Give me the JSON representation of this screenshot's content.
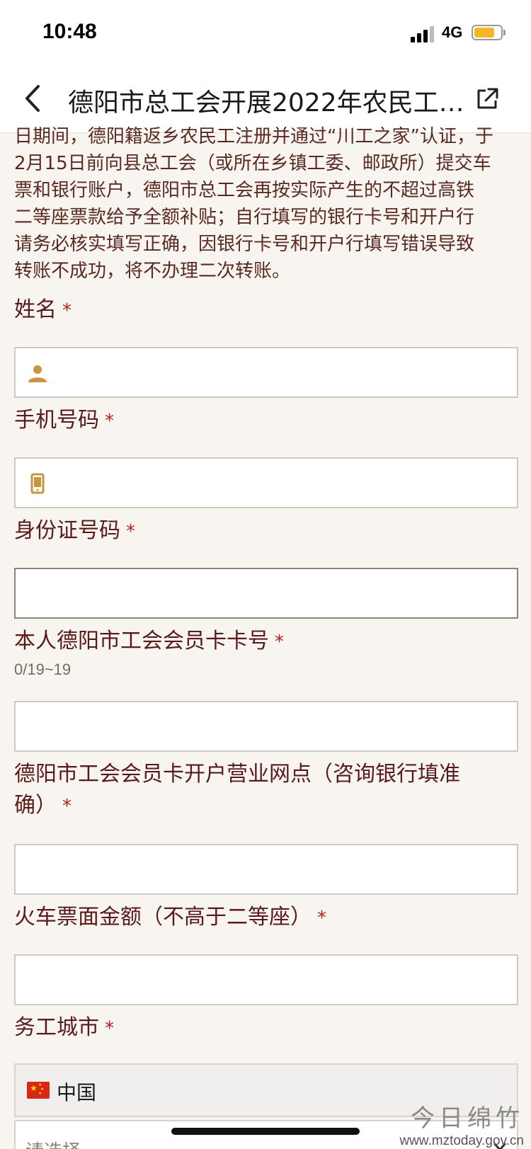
{
  "status_bar": {
    "time": "10:48",
    "network": "4G"
  },
  "nav": {
    "title": "德阳市总工会开展2022年农民工…"
  },
  "intro": {
    "lines": [
      "日期间，德阳籍返乡农民工注册并通过“川工之家”认证，于",
      "2月15日前向县总工会（或所在乡镇工委、邮政所）提交车",
      "票和银行账户，德阳市总工会再按实际产生的不超过高铁",
      "二等座票款给予全额补贴；自行填写的银行卡号和开户行",
      "请务必核实填写正确，因银行卡号和开户行填写错误导致",
      "转账不成功，将不办理二次转账。"
    ]
  },
  "form": {
    "required_mark": "*",
    "name_label": "姓名",
    "phone_label": "手机号码",
    "id_label": "身份证号码",
    "card_label": "本人德阳市工会会员卡卡号",
    "card_hint": "0/19~19",
    "branch_label_line1": "德阳市工会会员卡开户营业网点（咨询银行填准",
    "branch_label_line2": "确）",
    "ticket_label": "火车票面金额（不高于二等座）",
    "city_label": "务工城市",
    "country_value": "中国",
    "select_placeholder": "请选择"
  },
  "watermark": {
    "logo": "今日绵竹",
    "url": "www.mztoday.gov.cn"
  },
  "icons": {
    "person": "person-icon",
    "phone": "phone-icon",
    "back": "back-chevron-icon",
    "share": "share-icon"
  },
  "colors": {
    "accent": "#c8963e",
    "label": "#5a1a1a",
    "required": "#b11f1f"
  }
}
